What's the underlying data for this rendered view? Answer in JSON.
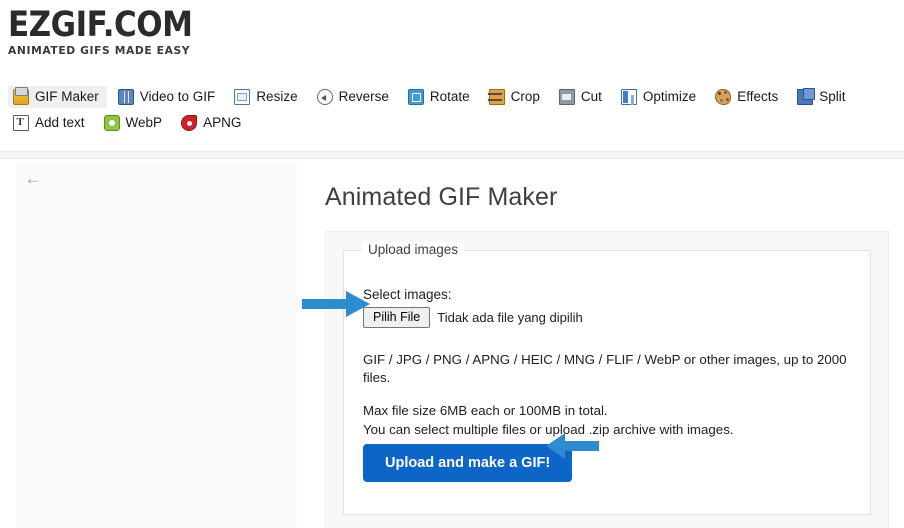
{
  "site": {
    "logo_main": "EZGIF.COM",
    "logo_sub": "ANIMATED GIFS MADE EASY"
  },
  "nav": {
    "items": [
      {
        "label": "GIF Maker",
        "icon": "gif-maker-icon",
        "active": true
      },
      {
        "label": "Video to GIF",
        "icon": "video-to-gif-icon",
        "active": false
      },
      {
        "label": "Resize",
        "icon": "resize-icon",
        "active": false
      },
      {
        "label": "Reverse",
        "icon": "reverse-icon",
        "active": false
      },
      {
        "label": "Rotate",
        "icon": "rotate-icon",
        "active": false
      },
      {
        "label": "Crop",
        "icon": "crop-icon",
        "active": false
      },
      {
        "label": "Cut",
        "icon": "cut-icon",
        "active": false
      },
      {
        "label": "Optimize",
        "icon": "optimize-icon",
        "active": false
      },
      {
        "label": "Effects",
        "icon": "effects-icon",
        "active": false
      },
      {
        "label": "Split",
        "icon": "split-icon",
        "active": false
      },
      {
        "label": "Add text",
        "icon": "add-text-icon",
        "active": false
      },
      {
        "label": "WebP",
        "icon": "webp-icon",
        "active": false
      },
      {
        "label": "APNG",
        "icon": "apng-icon",
        "active": false
      }
    ]
  },
  "sidebar": {
    "back_arrow": "←"
  },
  "main": {
    "page_title": "Animated GIF Maker",
    "fieldset_legend": "Upload images",
    "select_images_label": "Select images:",
    "file_button_label": "Pilih File",
    "file_status_text": "Tidak ada file yang dipilih",
    "formats_line1": "GIF / JPG / PNG / APNG / HEIC / MNG / FLIF / WebP or other images, up to 2000 files.",
    "formats_line2": "Max file size 6MB each or 100MB in total.",
    "formats_line3": "You can select multiple files or upload .zip archive with images.",
    "upload_button_label": "Upload and make a GIF!"
  },
  "annotations": {
    "arrow_to_file_button": "right-arrow-annotation",
    "arrow_to_upload_button": "left-arrow-annotation",
    "arrow_color": "#2d8bd0"
  },
  "colors": {
    "primary_button": "#0d65c8",
    "annotation_blue": "#2d8bd0",
    "panel_background": "#f7f8f9",
    "sidebar_background": "#fafafa",
    "active_tab_background": "#efefef"
  }
}
